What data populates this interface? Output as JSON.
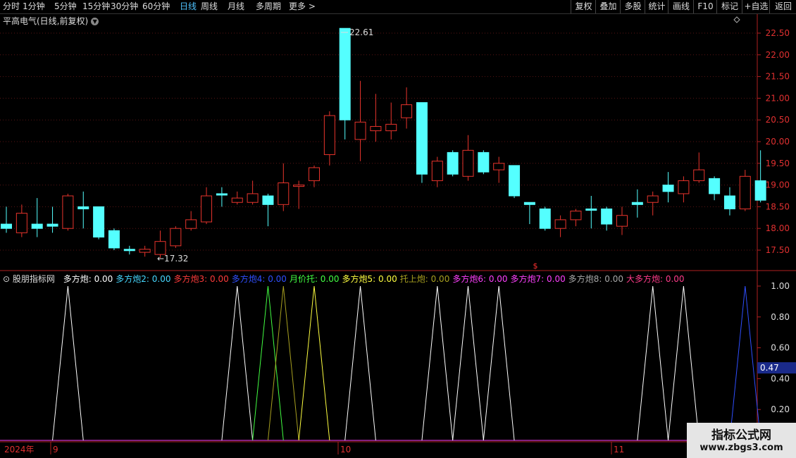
{
  "toolbar": {
    "periods": [
      "分时",
      "1分钟",
      "5分钟",
      "15分钟",
      "30分钟",
      "60分钟",
      "日线",
      "周线",
      "月线",
      "多周期",
      "更多 >"
    ],
    "active_period": "日线",
    "right_buttons": [
      "复权",
      "叠加",
      "多股",
      "统计",
      "画线",
      "F10",
      "标记",
      "+自选",
      "返回"
    ]
  },
  "stock": {
    "title": "平高电气(日线,前复权)",
    "high_label": "22.61",
    "low_label": "←17.32",
    "event_marker": "$"
  },
  "price_axis": {
    "labels": [
      "22.50",
      "22.00",
      "21.50",
      "21.00",
      "20.50",
      "20.00",
      "19.50",
      "19.00",
      "18.50",
      "18.00",
      "17.50"
    ]
  },
  "indicator": {
    "name": "股朋指标网",
    "items": [
      {
        "label": "多方炮: 0.00",
        "color": "#ffffff"
      },
      {
        "label": "多方炮2: 0.00",
        "color": "#46d8ff"
      },
      {
        "label": "多方炮3: 0.00",
        "color": "#ff3b3b"
      },
      {
        "label": "多方炮4: 0.00",
        "color": "#2f4fff"
      },
      {
        "label": "月价托: 0.00",
        "color": "#42ff42"
      },
      {
        "label": "多方炮5: 0.00",
        "color": "#ffff40"
      },
      {
        "label": "托上炮: 0.00",
        "color": "#a8a020"
      },
      {
        "label": "多方炮6: 0.00",
        "color": "#ff40ff"
      },
      {
        "label": "多方炮7: 0.00",
        "color": "#ff40ff"
      },
      {
        "label": "多方炮8: 0.00",
        "color": "#a8a8a8"
      },
      {
        "label": "大多方炮: 0.00",
        "color": "#ff3b8a"
      }
    ],
    "axis_labels": [
      "1.00",
      "0.80",
      "0.60",
      "0.40",
      "0.20"
    ],
    "current_value": "0.47"
  },
  "date_axis": {
    "labels": [
      "2024年",
      "9",
      "10",
      "11"
    ]
  },
  "watermark": {
    "line1": "指标公式网",
    "line2": "www.zbgs3.com"
  },
  "chart_data": {
    "type": "candlestick",
    "title": "平高电气(日线,前复权)",
    "y_range": [
      17.2,
      22.8
    ],
    "candles": [
      {
        "o": 18.0,
        "h": 18.5,
        "l": 17.9,
        "c": 18.1,
        "dir": "down"
      },
      {
        "o": 17.9,
        "h": 18.55,
        "l": 17.8,
        "c": 18.35,
        "dir": "up"
      },
      {
        "o": 18.1,
        "h": 18.7,
        "l": 17.8,
        "c": 18.0,
        "dir": "down"
      },
      {
        "o": 18.1,
        "h": 18.5,
        "l": 17.9,
        "c": 18.05,
        "dir": "down"
      },
      {
        "o": 18.0,
        "h": 18.8,
        "l": 17.95,
        "c": 18.75,
        "dir": "up"
      },
      {
        "o": 18.5,
        "h": 18.85,
        "l": 18.0,
        "c": 18.45,
        "dir": "down"
      },
      {
        "o": 18.5,
        "h": 18.5,
        "l": 17.75,
        "c": 17.8,
        "dir": "down"
      },
      {
        "o": 17.95,
        "h": 18.0,
        "l": 17.5,
        "c": 17.55,
        "dir": "down"
      },
      {
        "o": 17.52,
        "h": 17.6,
        "l": 17.4,
        "c": 17.5,
        "dir": "down"
      },
      {
        "o": 17.45,
        "h": 17.6,
        "l": 17.35,
        "c": 17.52,
        "dir": "up"
      },
      {
        "o": 17.4,
        "h": 17.95,
        "l": 17.32,
        "c": 17.7,
        "dir": "up"
      },
      {
        "o": 17.6,
        "h": 18.05,
        "l": 17.55,
        "c": 18.0,
        "dir": "up"
      },
      {
        "o": 18.0,
        "h": 18.4,
        "l": 17.95,
        "c": 18.2,
        "dir": "up"
      },
      {
        "o": 18.15,
        "h": 18.95,
        "l": 18.1,
        "c": 18.75,
        "dir": "up"
      },
      {
        "o": 18.8,
        "h": 18.95,
        "l": 18.5,
        "c": 18.8,
        "dir": "down"
      },
      {
        "o": 18.6,
        "h": 18.85,
        "l": 18.55,
        "c": 18.7,
        "dir": "up"
      },
      {
        "o": 18.6,
        "h": 19.1,
        "l": 18.55,
        "c": 18.8,
        "dir": "up"
      },
      {
        "o": 18.75,
        "h": 18.8,
        "l": 18.05,
        "c": 18.55,
        "dir": "down"
      },
      {
        "o": 18.55,
        "h": 19.5,
        "l": 18.4,
        "c": 19.05,
        "dir": "up"
      },
      {
        "o": 19.0,
        "h": 19.1,
        "l": 18.45,
        "c": 18.98,
        "dir": "up"
      },
      {
        "o": 19.1,
        "h": 19.45,
        "l": 18.95,
        "c": 19.4,
        "dir": "up"
      },
      {
        "o": 19.7,
        "h": 20.7,
        "l": 19.45,
        "c": 20.6,
        "dir": "up"
      },
      {
        "o": 22.61,
        "h": 22.61,
        "l": 20.05,
        "c": 20.5,
        "dir": "down"
      },
      {
        "o": 20.05,
        "h": 21.4,
        "l": 19.55,
        "c": 20.45,
        "dir": "up"
      },
      {
        "o": 20.25,
        "h": 21.1,
        "l": 20.0,
        "c": 20.35,
        "dir": "up"
      },
      {
        "o": 20.25,
        "h": 20.9,
        "l": 20.05,
        "c": 20.4,
        "dir": "up"
      },
      {
        "o": 20.55,
        "h": 21.25,
        "l": 20.3,
        "c": 20.85,
        "dir": "up"
      },
      {
        "o": 20.9,
        "h": 20.9,
        "l": 19.05,
        "c": 19.25,
        "dir": "down"
      },
      {
        "o": 19.1,
        "h": 19.65,
        "l": 18.95,
        "c": 19.55,
        "dir": "up"
      },
      {
        "o": 19.75,
        "h": 19.8,
        "l": 19.2,
        "c": 19.25,
        "dir": "down"
      },
      {
        "o": 19.2,
        "h": 20.15,
        "l": 19.1,
        "c": 19.8,
        "dir": "up"
      },
      {
        "o": 19.75,
        "h": 19.8,
        "l": 19.25,
        "c": 19.3,
        "dir": "down"
      },
      {
        "o": 19.35,
        "h": 19.65,
        "l": 19.05,
        "c": 19.5,
        "dir": "up"
      },
      {
        "o": 19.45,
        "h": 19.45,
        "l": 18.7,
        "c": 18.75,
        "dir": "down"
      },
      {
        "o": 18.6,
        "h": 18.6,
        "l": 18.1,
        "c": 18.55,
        "dir": "down"
      },
      {
        "o": 18.45,
        "h": 18.5,
        "l": 17.95,
        "c": 18.0,
        "dir": "down"
      },
      {
        "o": 18.0,
        "h": 18.3,
        "l": 17.8,
        "c": 18.2,
        "dir": "up"
      },
      {
        "o": 18.2,
        "h": 18.45,
        "l": 18.05,
        "c": 18.4,
        "dir": "up"
      },
      {
        "o": 18.45,
        "h": 18.75,
        "l": 18.0,
        "c": 18.42,
        "dir": "down"
      },
      {
        "o": 18.45,
        "h": 18.5,
        "l": 17.95,
        "c": 18.1,
        "dir": "down"
      },
      {
        "o": 18.05,
        "h": 18.5,
        "l": 17.85,
        "c": 18.3,
        "dir": "up"
      },
      {
        "o": 18.6,
        "h": 18.9,
        "l": 18.25,
        "c": 18.55,
        "dir": "down"
      },
      {
        "o": 18.6,
        "h": 18.85,
        "l": 18.3,
        "c": 18.75,
        "dir": "up"
      },
      {
        "o": 19.0,
        "h": 19.3,
        "l": 18.6,
        "c": 18.85,
        "dir": "down"
      },
      {
        "o": 18.8,
        "h": 19.2,
        "l": 18.6,
        "c": 19.1,
        "dir": "up"
      },
      {
        "o": 19.1,
        "h": 19.75,
        "l": 19.05,
        "c": 19.35,
        "dir": "up"
      },
      {
        "o": 19.15,
        "h": 19.2,
        "l": 18.65,
        "c": 18.8,
        "dir": "down"
      },
      {
        "o": 18.75,
        "h": 18.95,
        "l": 18.3,
        "c": 18.45,
        "dir": "down"
      },
      {
        "o": 18.45,
        "h": 19.35,
        "l": 18.4,
        "c": 19.2,
        "dir": "up"
      },
      {
        "o": 19.1,
        "h": 19.8,
        "l": 18.6,
        "c": 18.65,
        "dir": "down"
      }
    ],
    "indicator_series": [
      {
        "color": "#ffffff",
        "peaks": [
          4,
          15,
          23,
          28,
          30,
          32,
          42,
          44
        ]
      },
      {
        "color": "#42ff42",
        "peaks": [
          17
        ]
      },
      {
        "color": "#a8a020",
        "peaks": [
          18
        ]
      },
      {
        "color": "#ffff40",
        "peaks": [
          20
        ]
      },
      {
        "color": "#2f4fff",
        "peaks": [
          48
        ]
      }
    ]
  }
}
